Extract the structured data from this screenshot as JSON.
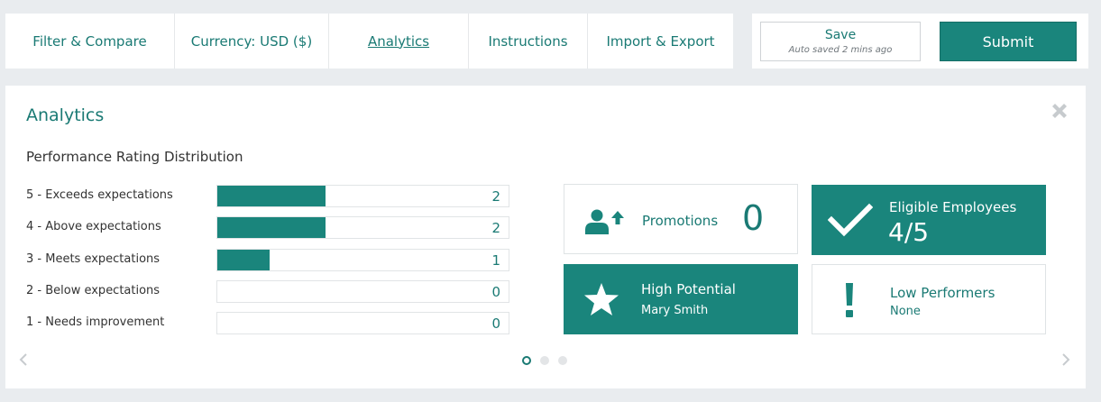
{
  "tabs": [
    {
      "label": "Filter & Compare"
    },
    {
      "label": "Currency: USD ($)"
    },
    {
      "label": "Analytics"
    },
    {
      "label": "Instructions"
    },
    {
      "label": "Import & Export"
    }
  ],
  "save": {
    "label": "Save",
    "autosave": "Auto saved 2 mins ago"
  },
  "submit": {
    "label": "Submit"
  },
  "panel": {
    "title": "Analytics",
    "section_title": "Performance Rating Distribution"
  },
  "ratings": [
    {
      "label": "5 - Exceeds expectations",
      "count": "2",
      "fill": 0.37
    },
    {
      "label": "4 - Above expectations",
      "count": "2",
      "fill": 0.37
    },
    {
      "label": "3 - Meets expectations",
      "count": "1",
      "fill": 0.18
    },
    {
      "label": "2 - Below expectations",
      "count": "0",
      "fill": 0
    },
    {
      "label": "1 - Needs improvement",
      "count": "0",
      "fill": 0
    }
  ],
  "cards": {
    "promotions": {
      "title": "Promotions",
      "value": "0",
      "icon": "user-up-icon"
    },
    "eligible": {
      "title": "Eligible Employees",
      "value": "4/5",
      "icon": "check-icon"
    },
    "high_potential": {
      "title": "High Potential",
      "sub": "Mary Smith",
      "icon": "star-icon"
    },
    "low_performers": {
      "title": "Low Performers",
      "sub": "None",
      "icon": "exclamation-icon"
    }
  },
  "carousel": {
    "active_index": 0,
    "count": 3
  },
  "colors": {
    "accent": "#1a857c",
    "accent_text": "#1a7a74",
    "background": "#e9ecef"
  }
}
